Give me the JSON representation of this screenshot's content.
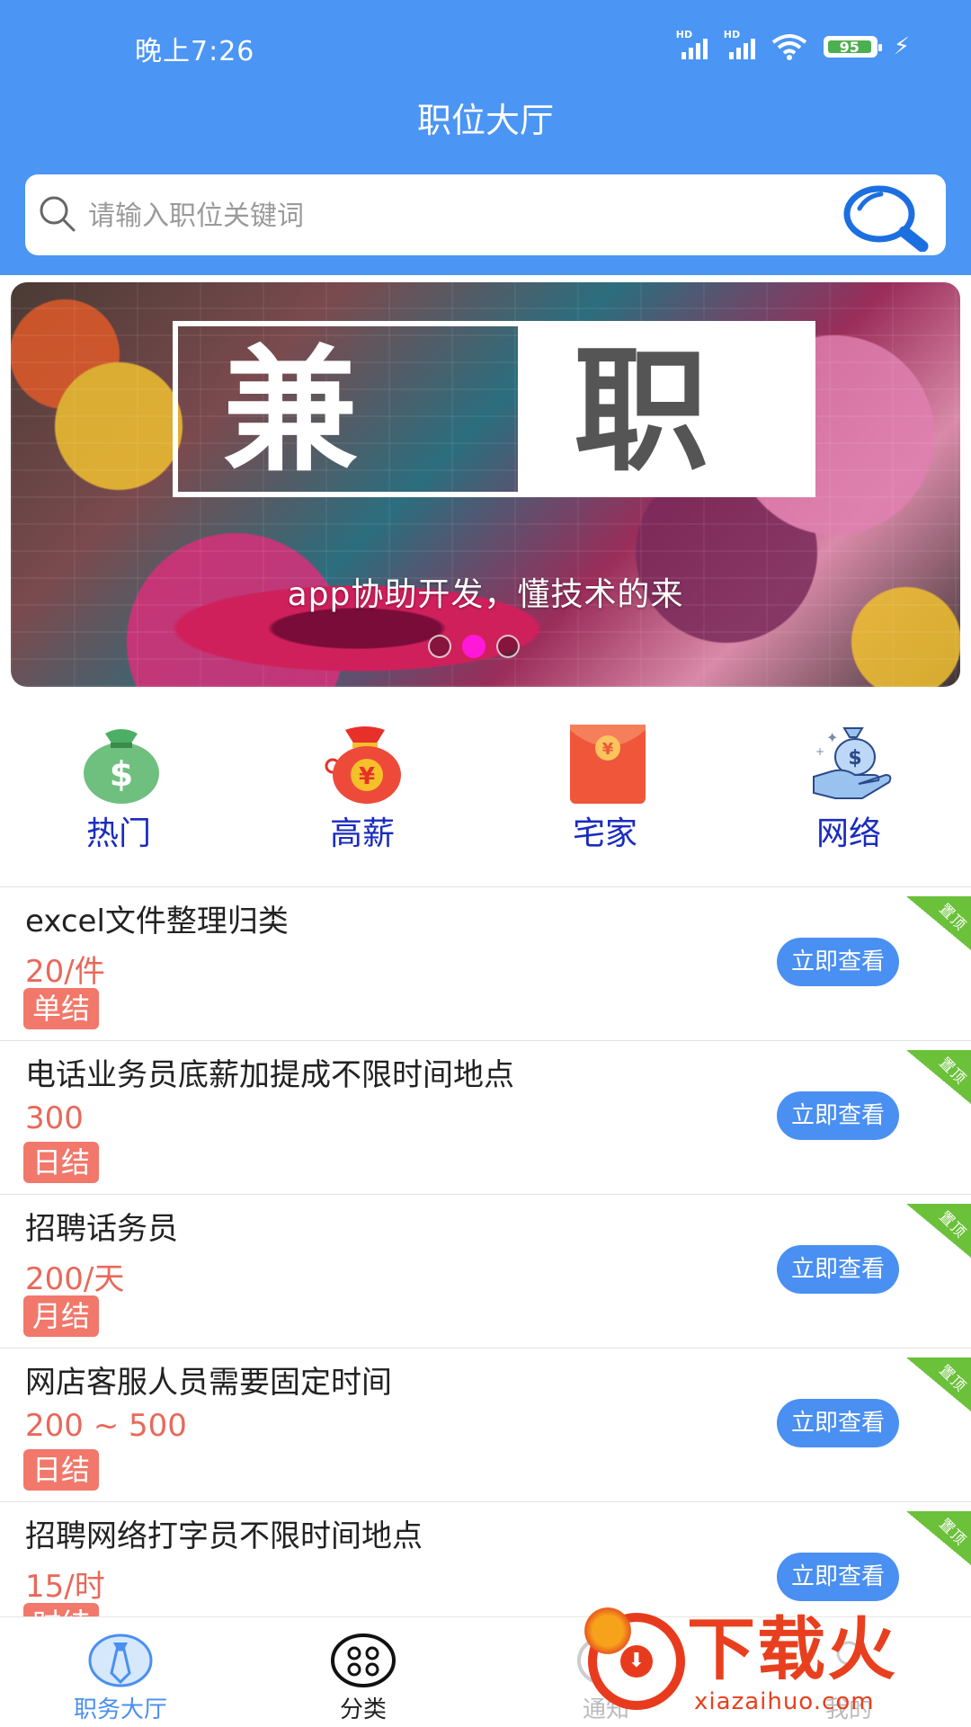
{
  "status_bar": {
    "time": "晚上7:26",
    "battery": "95",
    "network_label": "HD"
  },
  "header": {
    "title": "职位大厅"
  },
  "search": {
    "placeholder": "请输入职位关键词"
  },
  "banner": {
    "sign_left_char": "兼",
    "sign_right_char": "职",
    "caption": "app协助开发，懂技术的来",
    "page_count": 3,
    "active_page": 2
  },
  "categories": [
    {
      "label": "热门",
      "icon": "money-bag-icon"
    },
    {
      "label": "高薪",
      "icon": "yen-bag-icon"
    },
    {
      "label": "宅家",
      "icon": "red-envelope-icon"
    },
    {
      "label": "网络",
      "icon": "hand-money-icon"
    }
  ],
  "jobs": [
    {
      "title": "excel文件整理归类",
      "salary": "20/件",
      "pay_type": "单结",
      "button": "立即查看",
      "ribbon": "置顶"
    },
    {
      "title": "电话业务员底薪加提成不限时间地点",
      "salary": "300",
      "pay_type": "日结",
      "button": "立即查看",
      "ribbon": "置顶"
    },
    {
      "title": "招聘话务员",
      "salary": "200/天",
      "pay_type": "月结",
      "button": "立即查看",
      "ribbon": "置顶"
    },
    {
      "title": "网店客服人员需要固定时间",
      "salary": "200 ~ 500",
      "pay_type": "日结",
      "button": "立即查看",
      "ribbon": "置顶"
    },
    {
      "title": "招聘网络打字员不限时间地点",
      "salary": "15/时",
      "pay_type": "时结",
      "button": "立即查看",
      "ribbon": "置顶"
    }
  ],
  "tabbar": [
    {
      "label": "职务大厅",
      "icon": "tie-icon",
      "active": true
    },
    {
      "label": "分类",
      "icon": "grid-dots-icon",
      "active": false
    },
    {
      "label": "通知",
      "icon": "bell-icon",
      "active": false
    },
    {
      "label": "我的",
      "icon": "user-icon",
      "active": false
    }
  ],
  "watermark": {
    "text": "下载火",
    "url": "xiazaihuo.com"
  },
  "colors": {
    "primary_blue": "#4b95f4",
    "category_label": "#1a2bc0",
    "salary_red": "#e9685a",
    "pay_badge": "#f1786a",
    "view_button": "#4a8ff2",
    "ribbon_green": "#6bc13a",
    "dot_active": "#ff18d8"
  }
}
